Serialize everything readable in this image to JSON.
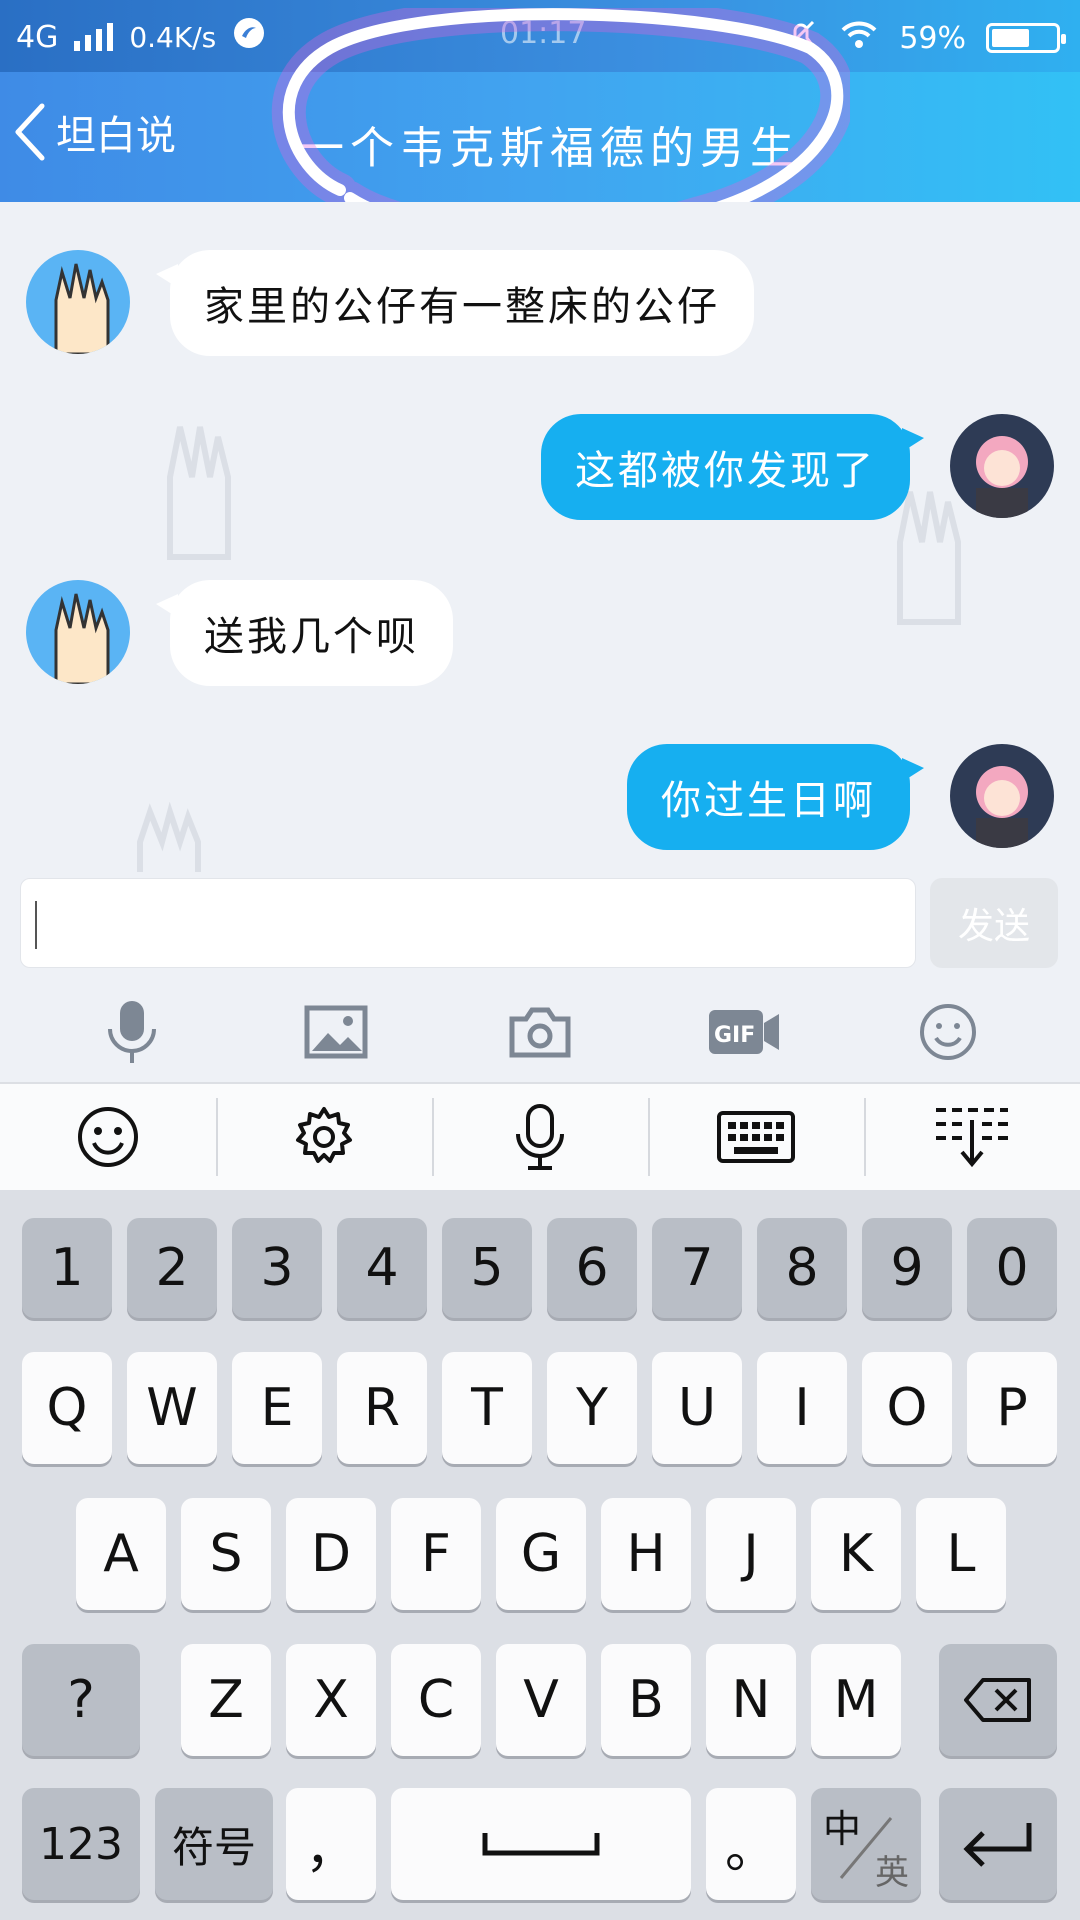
{
  "status_bar": {
    "network": "4G",
    "speed": "0.4K/s",
    "time": "01:17",
    "battery": "59%",
    "battery_level": 0.59
  },
  "header": {
    "back_label": "坦白说",
    "title": "一个韦克斯福德的男生"
  },
  "messages": [
    {
      "side": "in",
      "text": "家里的公仔有一整床的公仔"
    },
    {
      "side": "out",
      "text": "这都被你发现了"
    },
    {
      "side": "in",
      "text": "送我几个呗"
    },
    {
      "side": "out",
      "text": "你过生日啊"
    }
  ],
  "composer": {
    "value": "",
    "send_label": "发送"
  },
  "tools": [
    "microphone-icon",
    "image-icon",
    "camera-icon",
    "gif-icon",
    "emoji-icon"
  ],
  "keyboard_toolbar": [
    "emoji-icon",
    "gear-icon",
    "microphone-icon",
    "keyboard-icon",
    "collapse-keyboard-icon"
  ],
  "keyboard": {
    "row_numbers": [
      "1",
      "2",
      "3",
      "4",
      "5",
      "6",
      "7",
      "8",
      "9",
      "0"
    ],
    "row_1": [
      "Q",
      "W",
      "E",
      "R",
      "T",
      "Y",
      "U",
      "I",
      "O",
      "P"
    ],
    "row_2": [
      "A",
      "S",
      "D",
      "F",
      "G",
      "H",
      "J",
      "K",
      "L"
    ],
    "row_3": [
      "Z",
      "X",
      "C",
      "V",
      "B",
      "N",
      "M"
    ],
    "question": "?",
    "k123": "123",
    "symbols": "符号",
    "comma": "，",
    "period": "。",
    "lang_zh": "中",
    "lang_en": "英"
  }
}
